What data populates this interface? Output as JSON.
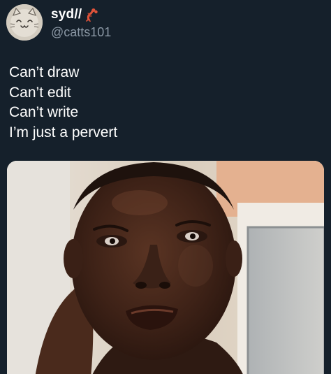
{
  "author": {
    "display_name": "syd//",
    "display_name_emoji": "lobster-icon",
    "handle": "@catts101",
    "avatar": "cat-face-avatar"
  },
  "tweet": {
    "lines": [
      "Can’t draw",
      "Can’t edit",
      "Can’t write",
      "I’m just a pervert"
    ]
  },
  "media": {
    "kind": "photo",
    "subject": "man-face-photo"
  },
  "colors": {
    "background": "#15202b",
    "text_primary": "#ffffff",
    "text_secondary": "#8b98a5",
    "emoji": "#e0533a"
  }
}
